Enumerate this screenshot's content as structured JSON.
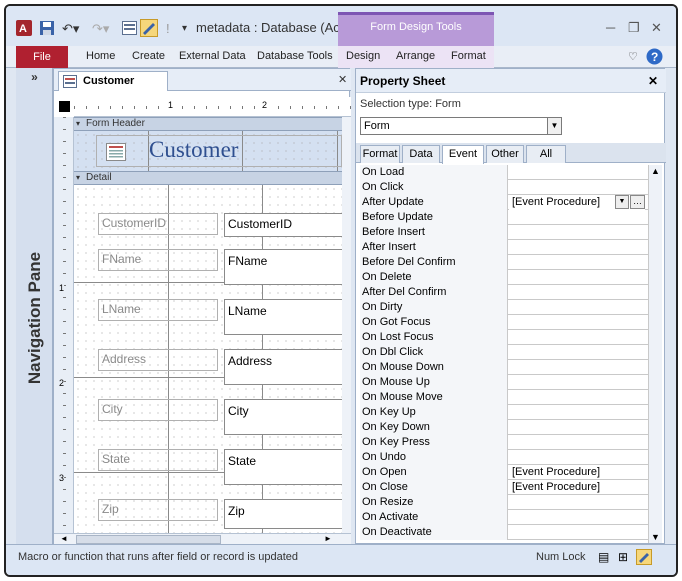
{
  "window": {
    "title": "metadata : Database (Ac...",
    "context_tab": "Form Design Tools"
  },
  "ribbon": {
    "tabs": [
      "File",
      "Home",
      "Create",
      "External Data",
      "Database Tools",
      "Design",
      "Arrange",
      "Format"
    ]
  },
  "nav": {
    "label": "Navigation Pane",
    "toggle": "»"
  },
  "document": {
    "tab_label": "Customer",
    "ruler_marks": [
      "1",
      "2"
    ],
    "v_ruler_marks": [
      "1",
      "2",
      "3"
    ],
    "header_band": "Form Header",
    "header_title": "Customer",
    "detail_band": "Detail",
    "fields": [
      {
        "label": "CustomerID",
        "value": "CustomerID"
      },
      {
        "label": "FName",
        "value": "FName"
      },
      {
        "label": "LName",
        "value": "LName"
      },
      {
        "label": "Address",
        "value": "Address"
      },
      {
        "label": "City",
        "value": "City"
      },
      {
        "label": "State",
        "value": "State"
      },
      {
        "label": "Zip",
        "value": "Zip"
      }
    ]
  },
  "property_sheet": {
    "title": "Property Sheet",
    "selection_type": "Selection type:  Form",
    "selected_object": "Form",
    "tabs": [
      "Format",
      "Data",
      "Event",
      "Other",
      "All"
    ],
    "active_tab": "Event",
    "properties": [
      {
        "name": "On Load",
        "value": ""
      },
      {
        "name": "On Click",
        "value": ""
      },
      {
        "name": "After Update",
        "value": "[Event Procedure]"
      },
      {
        "name": "Before Update",
        "value": ""
      },
      {
        "name": "Before Insert",
        "value": ""
      },
      {
        "name": "After Insert",
        "value": ""
      },
      {
        "name": "Before Del Confirm",
        "value": ""
      },
      {
        "name": "On Delete",
        "value": ""
      },
      {
        "name": "After Del Confirm",
        "value": ""
      },
      {
        "name": "On Dirty",
        "value": ""
      },
      {
        "name": "On Got Focus",
        "value": ""
      },
      {
        "name": "On Lost Focus",
        "value": ""
      },
      {
        "name": "On Dbl Click",
        "value": ""
      },
      {
        "name": "On Mouse Down",
        "value": ""
      },
      {
        "name": "On Mouse Up",
        "value": ""
      },
      {
        "name": "On Mouse Move",
        "value": ""
      },
      {
        "name": "On Key Up",
        "value": ""
      },
      {
        "name": "On Key Down",
        "value": ""
      },
      {
        "name": "On Key Press",
        "value": ""
      },
      {
        "name": "On Undo",
        "value": ""
      },
      {
        "name": "On Open",
        "value": "[Event Procedure]"
      },
      {
        "name": "On Close",
        "value": "[Event Procedure]"
      },
      {
        "name": "On Resize",
        "value": ""
      },
      {
        "name": "On Activate",
        "value": ""
      },
      {
        "name": "On Deactivate",
        "value": ""
      }
    ]
  },
  "status": {
    "message": "Macro or function that runs after field or record is updated",
    "num_lock": "Num Lock"
  }
}
